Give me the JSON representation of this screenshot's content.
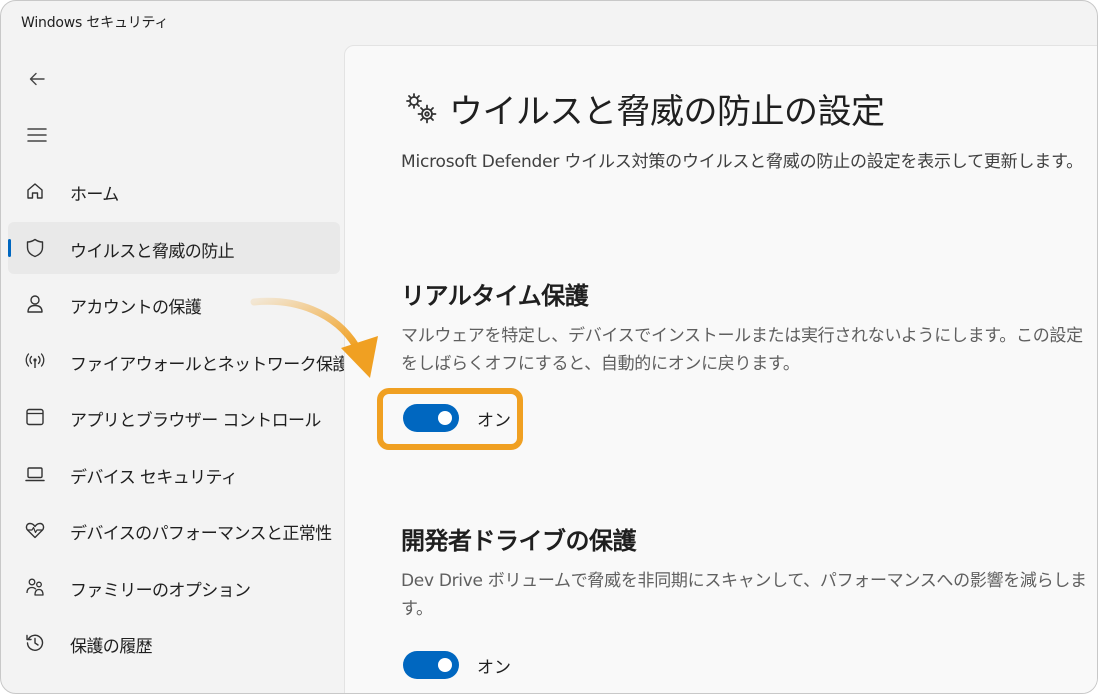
{
  "window": {
    "title": "Windows セキュリティ"
  },
  "sidebar": {
    "items": [
      {
        "label": "ホーム",
        "icon": "home-icon",
        "selected": false
      },
      {
        "label": "ウイルスと脅威の防止",
        "icon": "shield-icon",
        "selected": true
      },
      {
        "label": "アカウントの保護",
        "icon": "person-icon",
        "selected": false
      },
      {
        "label": "ファイアウォールとネットワーク保護",
        "icon": "wireless-icon",
        "selected": false
      },
      {
        "label": "アプリとブラウザー コントロール",
        "icon": "app-window-icon",
        "selected": false
      },
      {
        "label": "デバイス セキュリティ",
        "icon": "laptop-icon",
        "selected": false
      },
      {
        "label": "デバイスのパフォーマンスと正常性",
        "icon": "heart-pulse-icon",
        "selected": false
      },
      {
        "label": "ファミリーのオプション",
        "icon": "family-icon",
        "selected": false
      },
      {
        "label": "保護の履歴",
        "icon": "history-icon",
        "selected": false
      }
    ]
  },
  "main": {
    "title": "ウイルスと脅威の防止の設定",
    "description": "Microsoft Defender ウイルス対策のウイルスと脅威の防止の設定を表示して更新します。",
    "sections": [
      {
        "title": "リアルタイム保護",
        "description": "マルウェアを特定し、デバイスでインストールまたは実行されないようにします。この設定をしばらくオフにすると、自動的にオンに戻ります。",
        "toggle_label": "オン",
        "toggle_on": true
      },
      {
        "title": "開発者ドライブの保護",
        "description": "Dev Drive ボリュームで脅威を非同期にスキャンして、パフォーマンスへの影響を減らします。",
        "toggle_label": "オン",
        "toggle_on": true
      }
    ]
  },
  "colors": {
    "accent": "#0067c0",
    "highlight": "#f0a022"
  }
}
